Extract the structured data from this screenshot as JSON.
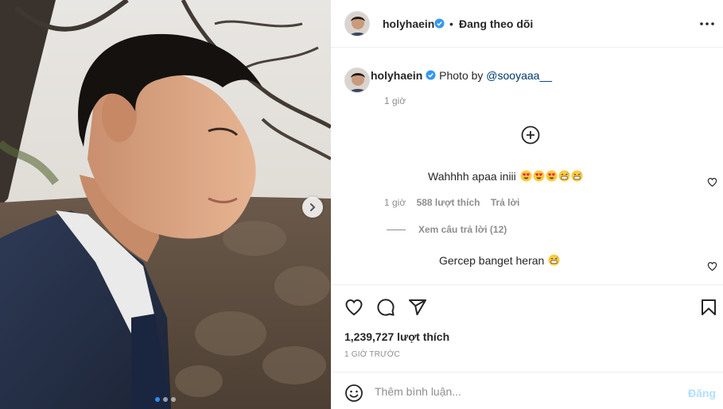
{
  "post": {
    "username": "holyhaein",
    "follow_separator": "•",
    "follow_status": "Đang theo dõi",
    "caption_prefix": "Photo by",
    "caption_mention": "@sooyaaa__",
    "caption_time": "1 giờ",
    "likes_text": "1,239,727 lượt thích",
    "posted_ago": "1 GIỜ TRƯỚC",
    "carousel": {
      "total": 3,
      "current": 1
    }
  },
  "comments": [
    {
      "text": "Wahhhh apaa iniii",
      "emojis": [
        "heart-eyes",
        "heart-eyes",
        "heart-eyes",
        "grinning-sweat",
        "grinning-sweat"
      ],
      "time": "1 giờ",
      "likes": "588 lượt thích",
      "reply_label": "Trả lời",
      "view_replies": "Xem câu trả lời (12)"
    },
    {
      "text": "Gercep banget heran",
      "emojis": [
        "grinning-sweat"
      ]
    }
  ],
  "composer": {
    "placeholder": "Thêm bình luận...",
    "post_label": "Đăng"
  },
  "colors": {
    "verified": "#3897f0",
    "post_disabled": "#b2dffc",
    "mention": "#00376b"
  },
  "icons": [
    "verified-badge-icon",
    "more-options-icon",
    "add-circle-icon",
    "heart-icon",
    "comment-icon",
    "share-icon",
    "bookmark-icon",
    "emoji-icon",
    "chevron-right-icon"
  ]
}
